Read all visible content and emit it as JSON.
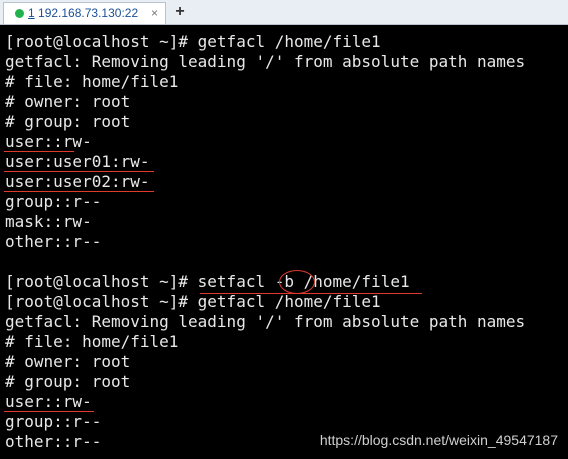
{
  "tab": {
    "number": "1",
    "title": "192.168.73.130:22",
    "close_icon": "×",
    "add_icon": "+"
  },
  "terminal": {
    "lines": [
      "[root@localhost ~]# getfacl /home/file1",
      "getfacl: Removing leading '/' from absolute path names",
      "# file: home/file1",
      "# owner: root",
      "# group: root",
      "user::rw-",
      "user:user01:rw-",
      "user:user02:rw-",
      "group::r--",
      "mask::rw-",
      "other::r--",
      "",
      "[root@localhost ~]# setfacl -b /home/file1",
      "[root@localhost ~]# getfacl /home/file1",
      "getfacl: Removing leading '/' from absolute path names",
      "# file: home/file1",
      "# owner: root",
      "# group: root",
      "user::rw-",
      "group::r--",
      "other::r--"
    ]
  },
  "watermark": "https://blog.csdn.net/weixin_49547187",
  "colors": {
    "terminal_bg": "#000000",
    "terminal_fg": "#e8e8e8",
    "annotation": "#e03a2e",
    "status_connected": "#22b14c"
  }
}
